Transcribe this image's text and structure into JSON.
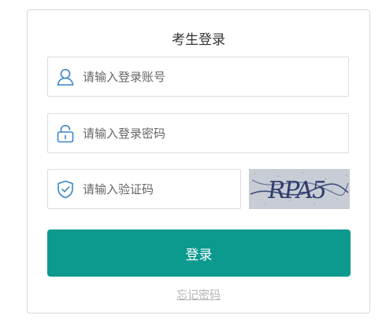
{
  "login": {
    "title": "考生登录",
    "username_placeholder": "请输入登录账号",
    "password_placeholder": "请输入登录密码",
    "captcha_placeholder": "请输入验证码",
    "captcha_text": "RPA5",
    "submit_label": "登录",
    "forgot_label": "忘记密码"
  },
  "icons": {
    "username": "user-icon",
    "password": "lock-icon",
    "captcha": "shield-check-icon"
  },
  "colors": {
    "accent": "#0c9a8f",
    "icon": "#3a84c8",
    "link": "#b4b4b4"
  }
}
